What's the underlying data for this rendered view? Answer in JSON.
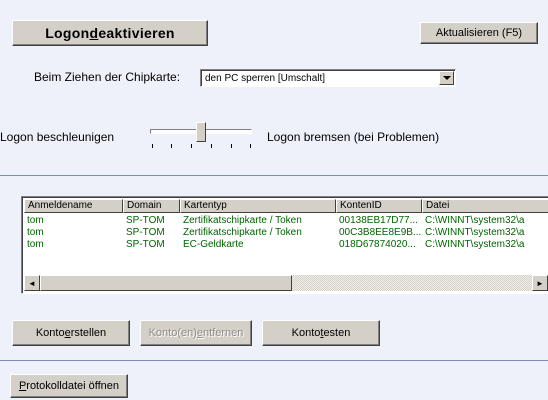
{
  "buttons": {
    "logon_deactivate": {
      "before": "Logon ",
      "mnemonic": "d",
      "after": "eaktivieren"
    },
    "refresh": "Aktualisieren (F5)",
    "create_account": {
      "before": "Konto ",
      "mnemonic": "e",
      "after": "rstellen"
    },
    "remove_account": {
      "before": "Konto(en) ",
      "mnemonic": "e",
      "after": "ntfernen"
    },
    "test_account": {
      "before": "Konto ",
      "mnemonic": "t",
      "after": "esten"
    },
    "open_log": {
      "before": "",
      "mnemonic": "P",
      "after": "rotokolldatei öffnen"
    }
  },
  "card_removal": {
    "label": "Beim Ziehen der Chipkarte:",
    "selected": "den PC sperren [Umschalt]"
  },
  "logon_speed": {
    "left_label": "Logon beschleunigen",
    "right_label": "Logon bremsen (bei Problemen)",
    "slider_level": 0.5
  },
  "accounts_table": {
    "columns": [
      "Anmeldename",
      "Domain",
      "Kartentyp",
      "KontenID",
      "Datei"
    ],
    "rows": [
      [
        "tom",
        "SP-TOM",
        "Zertifikatschipkarte / Token",
        "00138EB17D77...",
        "C:\\WINNT\\system32\\a"
      ],
      [
        "tom",
        "SP-TOM",
        "Zertifikatschipkarte / Token",
        "00C3B8EE8E9B...",
        "C:\\WINNT\\system32\\a"
      ],
      [
        "tom",
        "SP-TOM",
        "EC-Geldkarte",
        "018D67874020...",
        "C:\\WINNT\\system32\\a"
      ]
    ]
  },
  "scrollbar": {
    "left_arrow": "◄",
    "right_arrow": "►"
  },
  "colors": {
    "background": "#eef1f9",
    "row_text": "#006400",
    "separator": "#7a8fb8"
  }
}
